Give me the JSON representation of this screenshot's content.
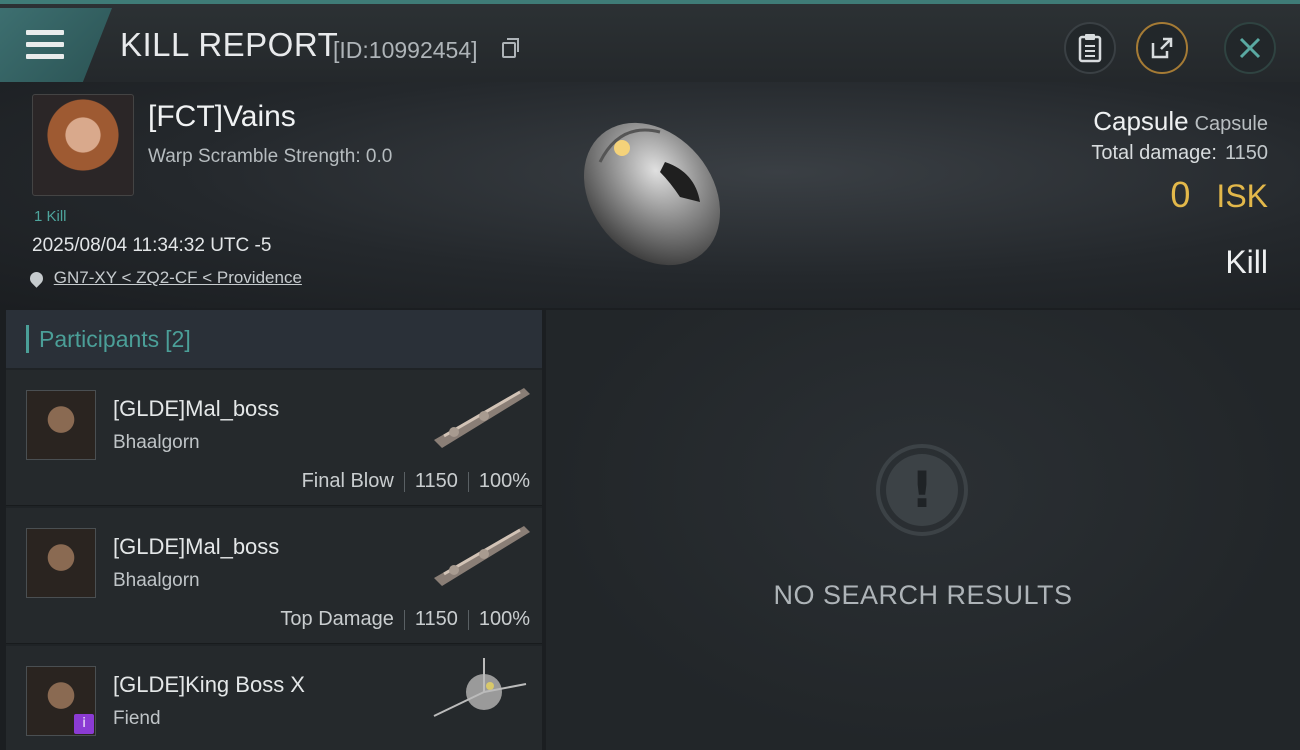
{
  "header": {
    "title": "KILL REPORT",
    "report_id": "[ID:10992454]",
    "buttons": {
      "menu": "menu-icon",
      "clipboard": "clipboard-icon",
      "share": "share-icon",
      "close": "close-icon"
    }
  },
  "victim": {
    "name": "[FCT]Vains",
    "warp_scramble": "Warp Scramble Strength: 0.0",
    "kills": "1 Kill",
    "timestamp": "2025/08/04 11:34:32 UTC -5",
    "location": "GN7-XY < ZQ2-CF < Providence",
    "ship_name": "Capsule",
    "ship_class": "Capsule",
    "total_damage_label": "Total damage:",
    "total_damage": "1150",
    "isk_value": "0",
    "isk_unit": "ISK",
    "result": "Kill"
  },
  "participants": {
    "label": "Participants",
    "count": "[2]",
    "items": [
      {
        "name": "[GLDE]Mal_boss",
        "ship": "Bhaalgorn",
        "role": "Final Blow",
        "damage": "1150",
        "percent": "100%"
      },
      {
        "name": "[GLDE]Mal_boss",
        "ship": "Bhaalgorn",
        "role": "Top Damage",
        "damage": "1150",
        "percent": "100%"
      },
      {
        "name": "[GLDE]King Boss X",
        "ship": "Fiend",
        "badge": "i"
      }
    ]
  },
  "results": {
    "empty_text": "NO SEARCH RESULTS"
  },
  "colors": {
    "accent": "#4b9f98",
    "isk": "#e3b84a",
    "badge": "#8b3bd4"
  }
}
